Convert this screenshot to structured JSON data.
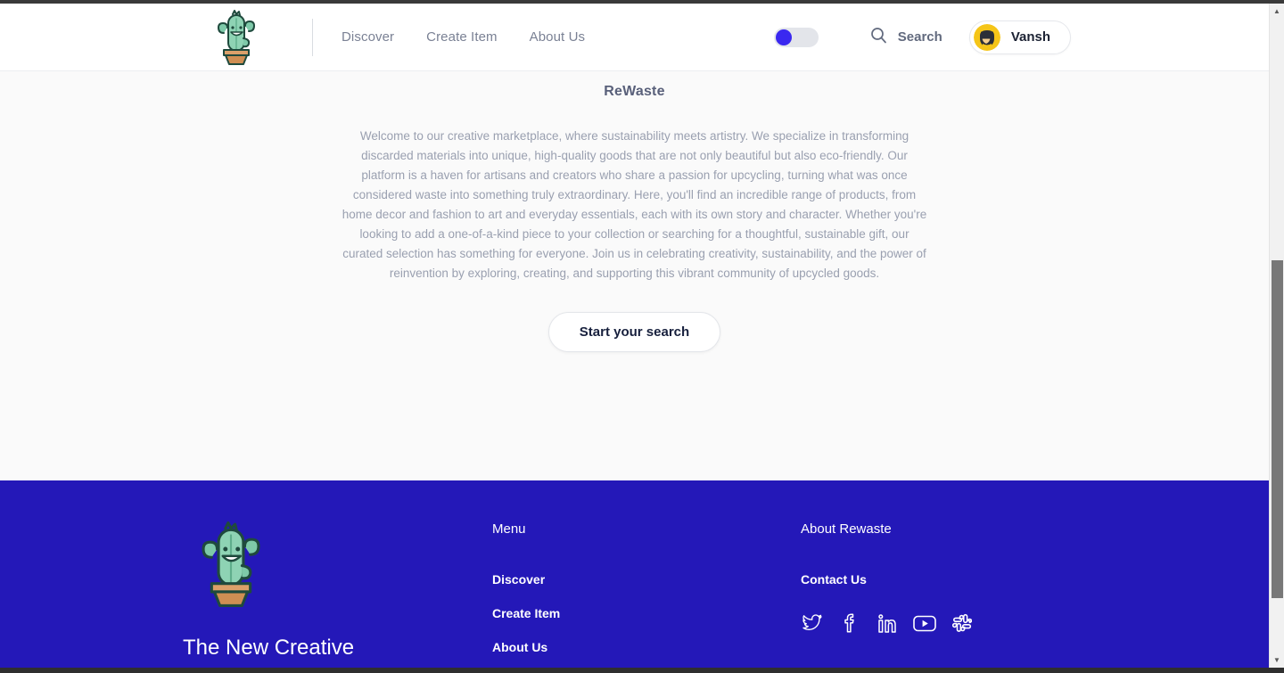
{
  "header": {
    "logo_alt": "cactus-logo",
    "nav": [
      {
        "label": "Discover"
      },
      {
        "label": "Create Item"
      },
      {
        "label": "About Us"
      }
    ],
    "theme_toggle": {
      "state": "off",
      "knob_color": "#3a28f0",
      "track_color": "#e3e5ea"
    },
    "search_label": "Search",
    "user": {
      "name": "Vansh",
      "avatar_alt": "batman-avatar"
    }
  },
  "hero": {
    "title": "ReWaste",
    "body": "Welcome to our creative marketplace, where sustainability meets artistry. We specialize in transforming discarded materials into unique, high-quality goods that are not only beautiful but also eco-friendly. Our platform is a haven for artisans and creators who share a passion for upcycling, turning what was once considered waste into something truly extraordinary. Here, you'll find an incredible range of products, from home decor and fashion to art and everyday essentials, each with its own story and character. Whether you're looking to add a one-of-a-kind piece to your collection or searching for a thoughtful, sustainable gift, our curated selection has something for everyone. Join us in celebrating creativity, sustainability, and the power of reinvention by exploring, creating, and supporting this vibrant community of upcycled goods.",
    "cta_label": "Start your search"
  },
  "footer": {
    "background_color": "#2418b8",
    "brand_name": "The New Creative",
    "menu_heading": "Menu",
    "menu_links": [
      {
        "label": "Discover"
      },
      {
        "label": "Create Item"
      },
      {
        "label": "About Us"
      }
    ],
    "about_heading": "About Rewaste",
    "contact_label": "Contact Us",
    "social": [
      {
        "name": "twitter-icon"
      },
      {
        "name": "facebook-icon"
      },
      {
        "name": "linkedin-icon"
      },
      {
        "name": "youtube-icon"
      },
      {
        "name": "slack-icon"
      }
    ]
  },
  "scrollbar": {
    "up_arrow": "▲",
    "down_arrow": "▼"
  }
}
